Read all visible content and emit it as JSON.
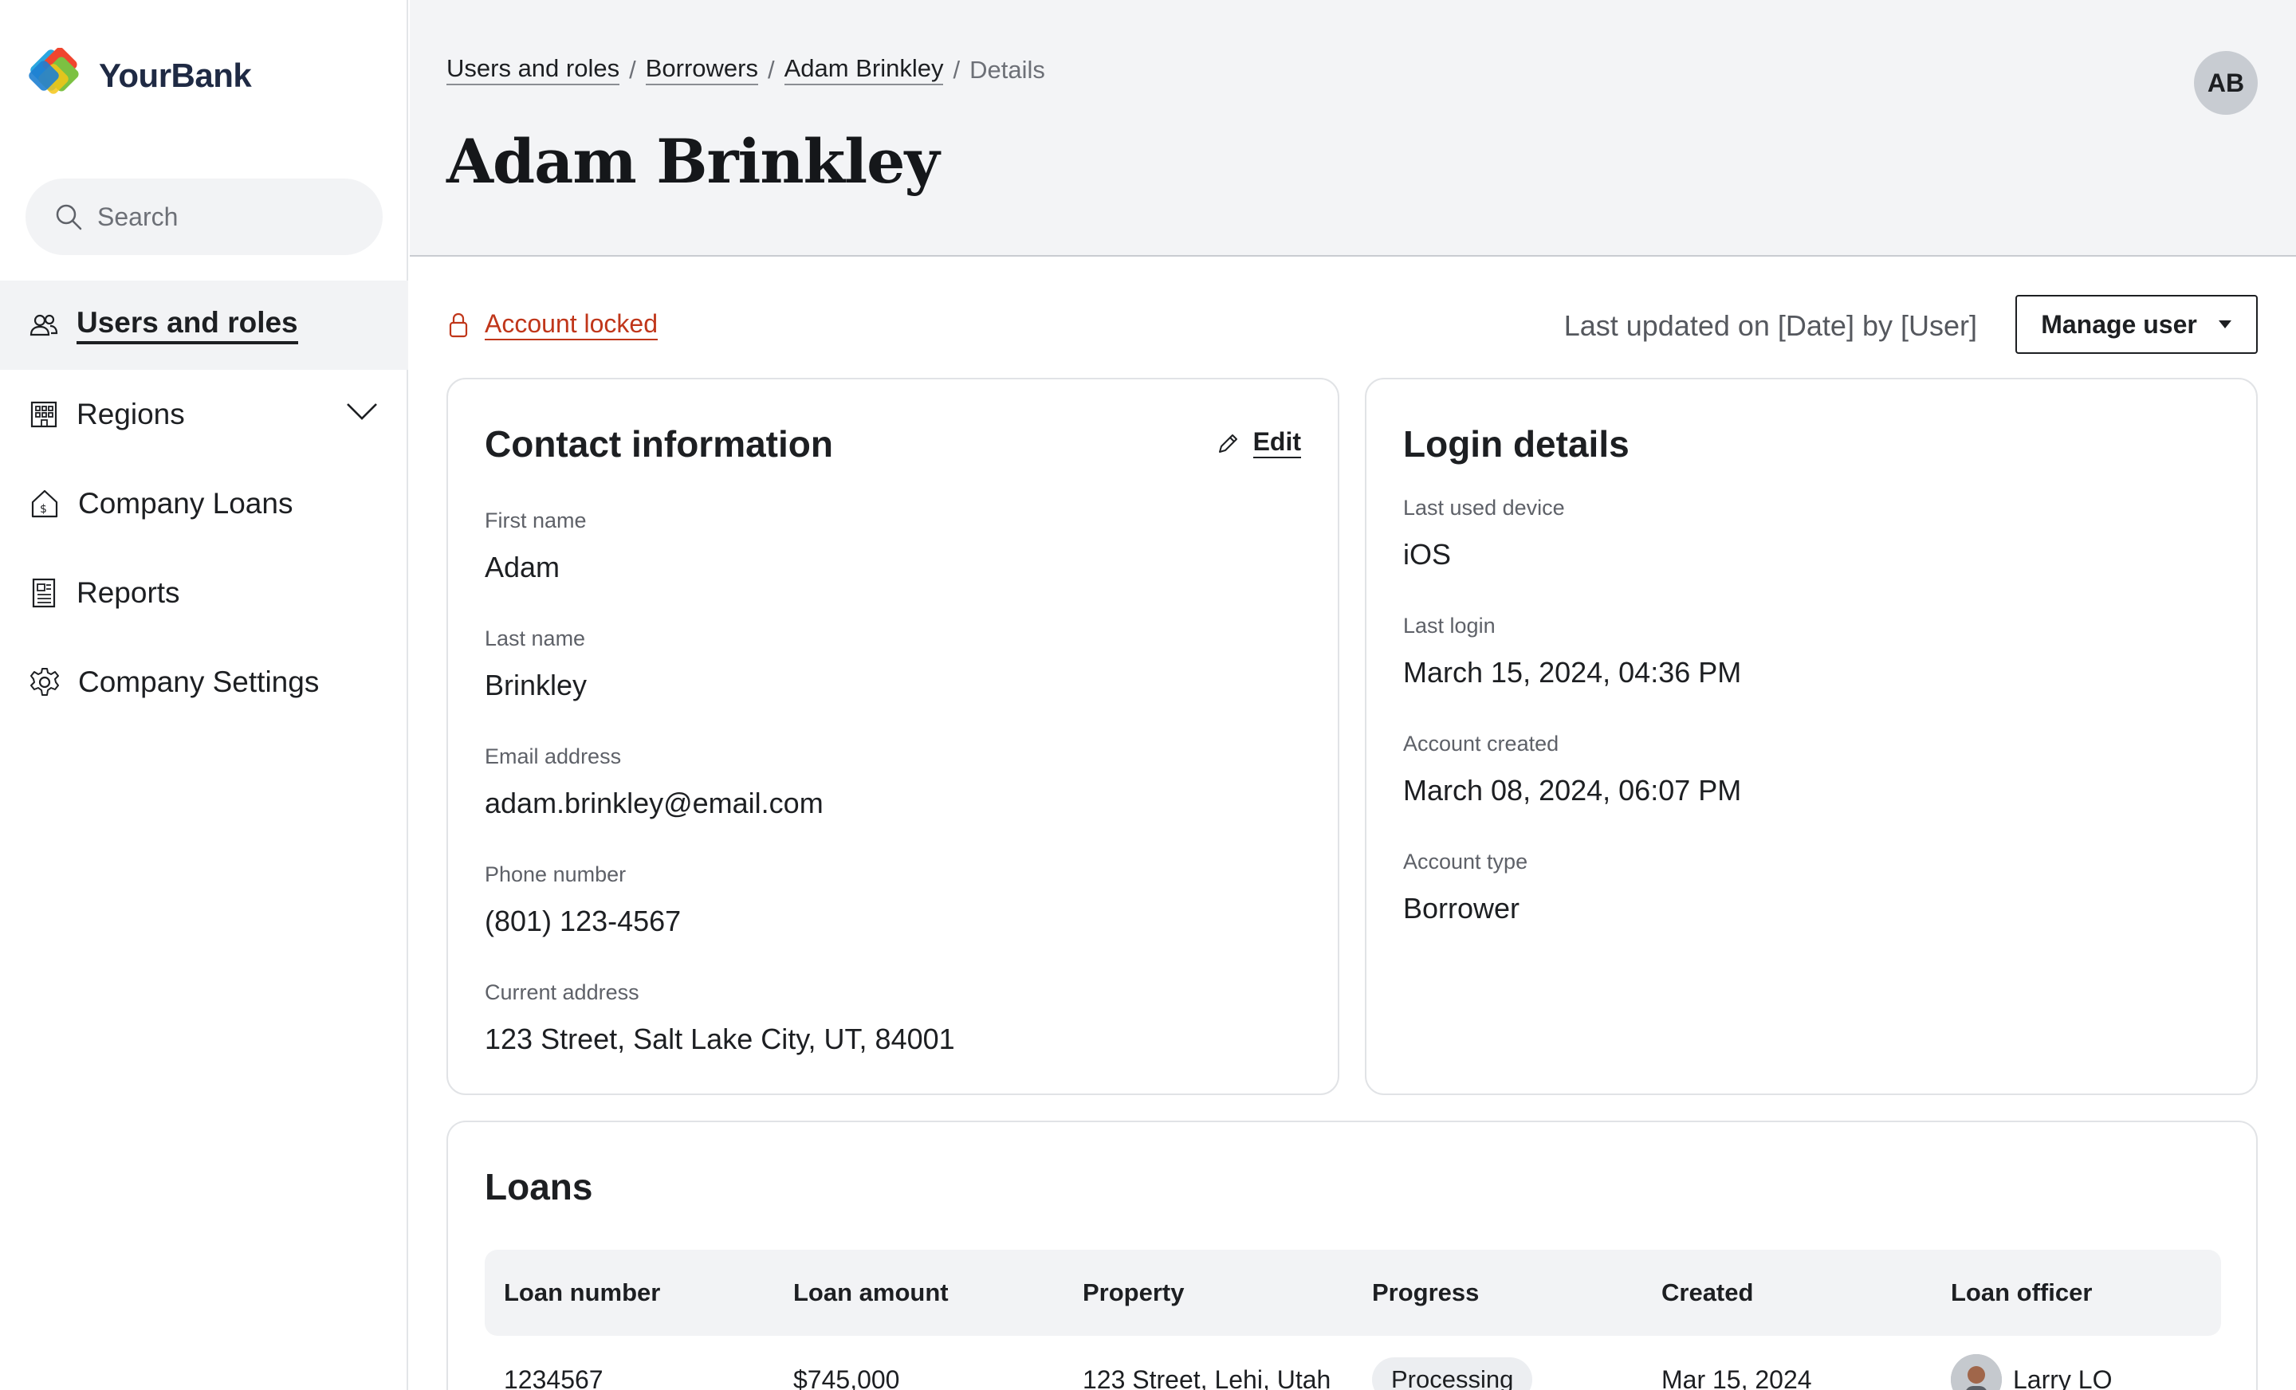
{
  "brand": {
    "name": "YourBank"
  },
  "sidebar": {
    "search_placeholder": "Search",
    "items": [
      {
        "label": "Users and roles",
        "icon": "users-icon",
        "active": true
      },
      {
        "label": "Regions",
        "icon": "building-icon",
        "expandable": true
      },
      {
        "label": "Company Loans",
        "icon": "house-dollar-icon"
      },
      {
        "label": "Reports",
        "icon": "report-icon"
      },
      {
        "label": "Company Settings",
        "icon": "gear-icon"
      }
    ]
  },
  "header": {
    "breadcrumb": [
      "Users and roles",
      "Borrowers",
      "Adam Brinkley",
      "Details"
    ],
    "title": "Adam Brinkley",
    "avatar_initials": "AB"
  },
  "status": {
    "lock_label": "Account locked",
    "last_updated": "Last updated on [Date] by [User]",
    "manage_label": "Manage user"
  },
  "contact": {
    "title": "Contact information",
    "edit_label": "Edit",
    "fields": [
      {
        "label": "First name",
        "value": "Adam"
      },
      {
        "label": "Last name",
        "value": "Brinkley"
      },
      {
        "label": "Email address",
        "value": "adam.brinkley@email.com"
      },
      {
        "label": "Phone number",
        "value": "(801) 123-4567"
      },
      {
        "label": "Current address",
        "value": "123 Street, Salt Lake City, UT, 84001"
      }
    ]
  },
  "login": {
    "title": "Login details",
    "fields": [
      {
        "label": "Last used device",
        "value": "iOS"
      },
      {
        "label": "Last login",
        "value": "March 15, 2024, 04:36 PM"
      },
      {
        "label": "Account created",
        "value": "March 08, 2024, 06:07 PM"
      },
      {
        "label": "Account type",
        "value": "Borrower"
      }
    ]
  },
  "loans": {
    "title": "Loans",
    "columns": [
      "Loan number",
      "Loan amount",
      "Property",
      "Progress",
      "Created",
      "Loan officer"
    ],
    "rows": [
      {
        "number": "1234567",
        "amount": "$745,000",
        "property": "123 Street, Lehi, Utah",
        "progress": "Processing",
        "created": "Mar 15, 2024",
        "officer": "Larry LO"
      }
    ]
  },
  "colors": {
    "accent_red": "#c0361a",
    "header_bg": "#f3f4f6",
    "text": "#1d1f22"
  }
}
